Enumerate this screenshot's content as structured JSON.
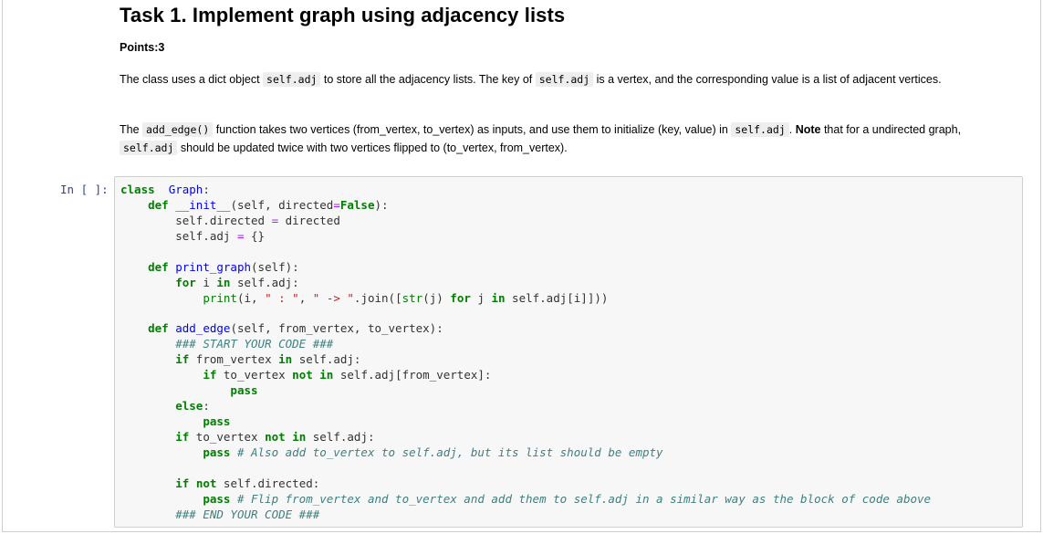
{
  "task": {
    "title": "Task 1. Implement graph using adjacency lists",
    "points": "Points:3"
  },
  "para1": {
    "t1": "The class uses a dict object ",
    "c1": "self.adj",
    "t2": " to store all the adjacency lists. The key of ",
    "c2": "self.adj",
    "t3": " is a vertex, and the corresponding value is a list of adjacent vertices."
  },
  "para2": {
    "t0": "The ",
    "c0": "add_edge()",
    "t1": " function takes two vertices (from_vertex, to_vertex) as inputs, and use them to initialize (key, value) in ",
    "c1": "self.adj",
    "t2": ". ",
    "bold": "Note",
    "t3": " that for a undirected graph, ",
    "c2": "self.adj",
    "t4": " should be updated twice with two vertices flipped to (to_vertex, from_vertex)."
  },
  "cell": {
    "prompt": "In [ ]:",
    "code_lines": [
      [
        [
          "kw",
          "class"
        ],
        [
          "",
          "  "
        ],
        [
          "fn",
          "Graph"
        ],
        [
          "",
          ":"
        ]
      ],
      [
        [
          "",
          "    "
        ],
        [
          "kw",
          "def"
        ],
        [
          "",
          " "
        ],
        [
          "fn",
          "__init__"
        ],
        [
          "",
          "(self, directed"
        ],
        [
          "op",
          "="
        ],
        [
          "kw",
          "False"
        ],
        [
          "",
          "):"
        ]
      ],
      [
        [
          "",
          "        self.directed "
        ],
        [
          "op",
          "="
        ],
        [
          "",
          " directed"
        ]
      ],
      [
        [
          "",
          "        self.adj "
        ],
        [
          "op",
          "="
        ],
        [
          "",
          " {}"
        ]
      ],
      [],
      [
        [
          "",
          "    "
        ],
        [
          "kw",
          "def"
        ],
        [
          "",
          " "
        ],
        [
          "fn",
          "print_graph"
        ],
        [
          "",
          "(self):"
        ]
      ],
      [
        [
          "",
          "        "
        ],
        [
          "kw",
          "for"
        ],
        [
          "",
          " i "
        ],
        [
          "kw",
          "in"
        ],
        [
          "",
          " self.adj:"
        ]
      ],
      [
        [
          "",
          "            "
        ],
        [
          "bi",
          "print"
        ],
        [
          "",
          "(i, "
        ],
        [
          "str",
          "\" : \""
        ],
        [
          "",
          ", "
        ],
        [
          "str",
          "\" -> \""
        ],
        [
          "",
          ".join(["
        ],
        [
          "bi",
          "str"
        ],
        [
          "",
          "(j) "
        ],
        [
          "kw",
          "for"
        ],
        [
          "",
          " j "
        ],
        [
          "kw",
          "in"
        ],
        [
          "",
          " self.adj[i]]))"
        ]
      ],
      [],
      [
        [
          "",
          "    "
        ],
        [
          "kw",
          "def"
        ],
        [
          "",
          " "
        ],
        [
          "fn",
          "add_edge"
        ],
        [
          "",
          "(self, from_vertex, to_vertex):"
        ]
      ],
      [
        [
          "",
          "        "
        ],
        [
          "cm",
          "### START YOUR CODE ###"
        ]
      ],
      [
        [
          "",
          "        "
        ],
        [
          "kw",
          "if"
        ],
        [
          "",
          " from_vertex "
        ],
        [
          "kw",
          "in"
        ],
        [
          "",
          " self.adj:"
        ]
      ],
      [
        [
          "",
          "            "
        ],
        [
          "kw",
          "if"
        ],
        [
          "",
          " to_vertex "
        ],
        [
          "kw",
          "not"
        ],
        [
          "",
          " "
        ],
        [
          "kw",
          "in"
        ],
        [
          "",
          " self.adj[from_vertex]:"
        ]
      ],
      [
        [
          "",
          "                "
        ],
        [
          "kw",
          "pass"
        ]
      ],
      [
        [
          "",
          "        "
        ],
        [
          "kw",
          "else"
        ],
        [
          "",
          ":"
        ]
      ],
      [
        [
          "",
          "            "
        ],
        [
          "kw",
          "pass"
        ]
      ],
      [
        [
          "",
          "        "
        ],
        [
          "kw",
          "if"
        ],
        [
          "",
          " to_vertex "
        ],
        [
          "kw",
          "not"
        ],
        [
          "",
          " "
        ],
        [
          "kw",
          "in"
        ],
        [
          "",
          " self.adj:"
        ]
      ],
      [
        [
          "",
          "            "
        ],
        [
          "kw",
          "pass"
        ],
        [
          "",
          " "
        ],
        [
          "cm",
          "# Also add to_vertex to self.adj, but its list should be empty"
        ]
      ],
      [],
      [
        [
          "",
          "        "
        ],
        [
          "kw",
          "if"
        ],
        [
          "",
          " "
        ],
        [
          "kw",
          "not"
        ],
        [
          "",
          " self.directed:"
        ]
      ],
      [
        [
          "",
          "            "
        ],
        [
          "kw",
          "pass"
        ],
        [
          "",
          " "
        ],
        [
          "cm",
          "# Flip from_vertex and to_vertex and add them to self.adj in a similar way as the block of code above"
        ]
      ],
      [
        [
          "",
          "        "
        ],
        [
          "cm",
          "### END YOUR CODE ###"
        ]
      ]
    ]
  }
}
